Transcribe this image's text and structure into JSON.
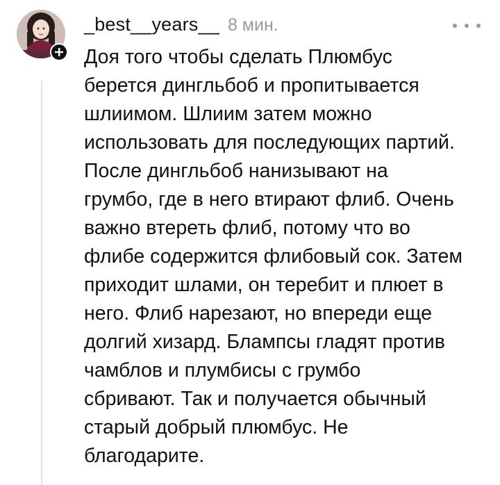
{
  "comment": {
    "author": {
      "username": "_best__years__",
      "avatar_icon": "user-avatar-photo",
      "follow_icon": "plus-icon"
    },
    "timestamp": "8 мин.",
    "more_icon": "more-dots-icon",
    "text": "Доя того чтобы сделать Плюмбус\nберется дингльбоб и пропитывается\nшлиимом. Шлиим затем можно\nиспользовать для последующих партий.\nПосле дингльбоб нанизывают на\nгрумбо, где в него втирают флиб. Очень\nважно втереть флиб, потому что во\nфлибе содержится флибовый сок. Затем\nприходит шлами, он теребит и плюет в\nнего. Флиб нарезают, но впереди еще\nдолгий хизард. Блампсы гладят против\nчамблов и плумбисы с грумбо\nсбривают. Так и получается обычный\nстарый добрый плюмбус. Не\nблагодарите."
  },
  "colors": {
    "text": "#111111",
    "muted": "#9a9a9a",
    "thread_line": "#e3e3e3",
    "badge": "#111111"
  }
}
